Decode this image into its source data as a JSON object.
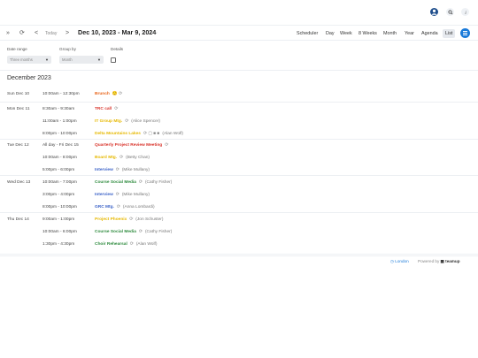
{
  "header": {
    "icons": [
      "avatar-icon",
      "search-icon",
      "info-icon"
    ]
  },
  "toolbar": {
    "collapse": "»",
    "refresh": "⟳",
    "prev": "<",
    "today": "Today",
    "next": ">",
    "range": "Dec 10, 2023 - Mar 9, 2024",
    "range_chevron": "⌵",
    "views": [
      "Scheduler",
      "Day",
      "Week",
      "8 Weeks",
      "Month",
      "Year",
      "Agenda",
      "List"
    ],
    "active_view": "List"
  },
  "filters": {
    "date_range_label": "Date range",
    "date_range_value": "Three months",
    "group_by_label": "Group by",
    "group_by_value": "Month",
    "details_label": "Details"
  },
  "month": "December 2023",
  "colors": {
    "orange": "#e8651a",
    "yellow": "#e6b800",
    "red": "#d9342b",
    "blue": "#3c63c8",
    "green": "#2e8b3e",
    "accent": "#1a7ad9"
  },
  "days": [
    {
      "label": "Sun Dec 10",
      "events": [
        {
          "time": "10:00am - 12:30pm",
          "title": "Brunch",
          "who": "",
          "extra": "🙂 ⟳",
          "color": "#e8651a"
        }
      ]
    },
    {
      "label": "Mon Dec 11",
      "events": [
        {
          "time": "8:30am - 9:30am",
          "title": "TRC call",
          "who": "",
          "extra": "⟳",
          "color": "#d9342b"
        },
        {
          "time": "11:00am - 1:00pm",
          "title": "IT Group Mtg.",
          "who": "(Alice Spencer)",
          "extra": "⟳",
          "color": "#e6b800"
        },
        {
          "time": "8:00pm - 10:00pm",
          "title": "Delta Mountains Lakes",
          "who": "(Alan Wolf)",
          "extra": "⟳ ▢ ■ ■",
          "color": "#e6b800"
        }
      ]
    },
    {
      "label": "Tue Dec 12",
      "events": [
        {
          "time": "All day - Fri Dec 15",
          "title": "Quarterly Project Review Meeting",
          "who": "",
          "extra": "⟳",
          "color": "#d9342b"
        },
        {
          "time": "10:00am - 8:00pm",
          "title": "Board Mtg.",
          "who": "(Betty Chan)",
          "extra": "⟳",
          "color": "#e6b800"
        },
        {
          "time": "5:00pm - 6:00pm",
          "title": "Interview",
          "who": "(Mike Mullany)",
          "extra": "⟳",
          "color": "#3c63c8"
        }
      ]
    },
    {
      "label": "Wed Dec 13",
      "events": [
        {
          "time": "10:00am - 7:00pm",
          "title": "Course Social Media",
          "who": "(Cathy Fisher)",
          "extra": "⟳",
          "color": "#2e8b3e"
        },
        {
          "time": "3:00pm - 4:00pm",
          "title": "Interview",
          "who": "(Mike Mullany)",
          "extra": "⟳",
          "color": "#3c63c8"
        },
        {
          "time": "8:00pm - 10:00pm",
          "title": "GRC Mtg.",
          "who": "(Anna Lombardi)",
          "extra": "⟳",
          "color": "#3c63c8"
        }
      ]
    },
    {
      "label": "Thu Dec 14",
      "events": [
        {
          "time": "9:00am - 1:00pm",
          "title": "Project Phoenix",
          "who": "(Jon Schuster)",
          "extra": "⟳",
          "color": "#e6b800"
        },
        {
          "time": "10:00am - 6:00pm",
          "title": "Course Social Media",
          "who": "(Cathy Fisher)",
          "extra": "⟳",
          "color": "#2e8b3e"
        },
        {
          "time": "1:30pm - 4:30pm",
          "title": "Choir Rehearsal",
          "who": "(Alan Wolf)",
          "extra": "⟳",
          "color": "#2e8b3e"
        }
      ]
    }
  ],
  "footer": {
    "location": "London",
    "powered": "Powered by",
    "brand": "teamup"
  }
}
